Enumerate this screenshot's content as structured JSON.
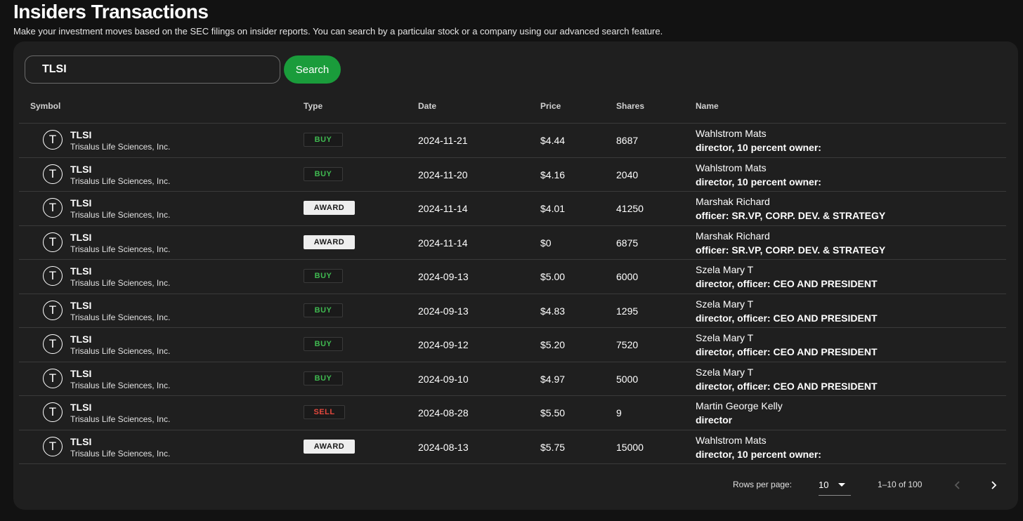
{
  "header": {
    "title": "Insiders Transactions",
    "subtitle": "Make your investment moves based on the SEC filings on insider reports. You can search by a particular stock or a company using our advanced search feature."
  },
  "search": {
    "value": "TLSI",
    "button_label": "Search"
  },
  "table": {
    "columns": [
      "Symbol",
      "Type",
      "Date",
      "Price",
      "Shares",
      "Name"
    ],
    "rows": [
      {
        "avatar": "T",
        "ticker": "TLSI",
        "company": "Trisalus Life Sciences, Inc.",
        "type": "BUY",
        "date": "2024-11-21",
        "price": "$4.44",
        "shares": "8687",
        "person": "Wahlstrom Mats",
        "role": "director, 10 percent owner:"
      },
      {
        "avatar": "T",
        "ticker": "TLSI",
        "company": "Trisalus Life Sciences, Inc.",
        "type": "BUY",
        "date": "2024-11-20",
        "price": "$4.16",
        "shares": "2040",
        "person": "Wahlstrom Mats",
        "role": "director, 10 percent owner:"
      },
      {
        "avatar": "T",
        "ticker": "TLSI",
        "company": "Trisalus Life Sciences, Inc.",
        "type": "AWARD",
        "date": "2024-11-14",
        "price": "$4.01",
        "shares": "41250",
        "person": "Marshak Richard",
        "role": "officer: SR.VP, CORP. DEV. & STRATEGY"
      },
      {
        "avatar": "T",
        "ticker": "TLSI",
        "company": "Trisalus Life Sciences, Inc.",
        "type": "AWARD",
        "date": "2024-11-14",
        "price": "$0",
        "shares": "6875",
        "person": "Marshak Richard",
        "role": "officer: SR.VP, CORP. DEV. & STRATEGY"
      },
      {
        "avatar": "T",
        "ticker": "TLSI",
        "company": "Trisalus Life Sciences, Inc.",
        "type": "BUY",
        "date": "2024-09-13",
        "price": "$5.00",
        "shares": "6000",
        "person": "Szela Mary T",
        "role": "director, officer: CEO AND PRESIDENT"
      },
      {
        "avatar": "T",
        "ticker": "TLSI",
        "company": "Trisalus Life Sciences, Inc.",
        "type": "BUY",
        "date": "2024-09-13",
        "price": "$4.83",
        "shares": "1295",
        "person": "Szela Mary T",
        "role": "director, officer: CEO AND PRESIDENT"
      },
      {
        "avatar": "T",
        "ticker": "TLSI",
        "company": "Trisalus Life Sciences, Inc.",
        "type": "BUY",
        "date": "2024-09-12",
        "price": "$5.20",
        "shares": "7520",
        "person": "Szela Mary T",
        "role": "director, officer: CEO AND PRESIDENT"
      },
      {
        "avatar": "T",
        "ticker": "TLSI",
        "company": "Trisalus Life Sciences, Inc.",
        "type": "BUY",
        "date": "2024-09-10",
        "price": "$4.97",
        "shares": "5000",
        "person": "Szela Mary T",
        "role": "director, officer: CEO AND PRESIDENT"
      },
      {
        "avatar": "T",
        "ticker": "TLSI",
        "company": "Trisalus Life Sciences, Inc.",
        "type": "SELL",
        "date": "2024-08-28",
        "price": "$5.50",
        "shares": "9",
        "person": "Martin George Kelly",
        "role": "director"
      },
      {
        "avatar": "T",
        "ticker": "TLSI",
        "company": "Trisalus Life Sciences, Inc.",
        "type": "AWARD",
        "date": "2024-08-13",
        "price": "$5.75",
        "shares": "15000",
        "person": "Wahlstrom Mats",
        "role": "director, 10 percent owner:"
      }
    ]
  },
  "pagination": {
    "rows_per_page_label": "Rows per page:",
    "rows_per_page_value": "10",
    "range": "1–10 of 100"
  },
  "colors": {
    "background": "#121212",
    "card": "#1f1f1f",
    "accent_green": "#1a9c3b",
    "buy": "#3fb950",
    "sell": "#e5483d",
    "award_bg": "#eeeeee"
  },
  "icons": {
    "dropdown": "chevron-down-icon",
    "prev": "chevron-left-icon",
    "next": "chevron-right-icon"
  }
}
